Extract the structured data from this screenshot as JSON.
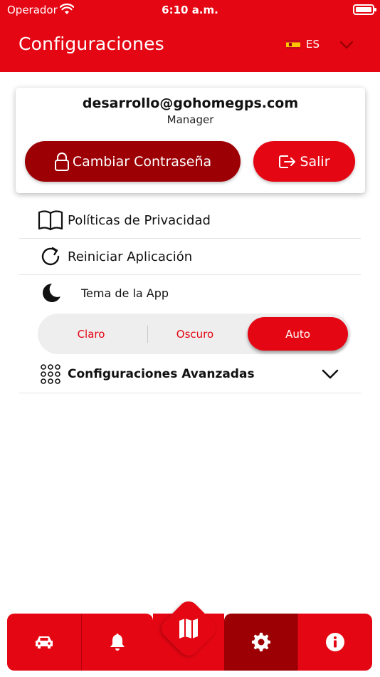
{
  "status_bar": {
    "carrier": "Operador",
    "time": "6:10 a.m."
  },
  "header": {
    "title": "Configuraciones",
    "language_code": "ES",
    "language_flag": "spain-flag-icon"
  },
  "account": {
    "email": "desarrollo@gohomegps.com",
    "role": "Manager",
    "change_password_label": "Cambiar Contraseña",
    "logout_label": "Salir"
  },
  "menu": {
    "privacy_label": "Políticas de Privacidad",
    "restart_label": "Reiniciar Aplicación",
    "theme_label": "Tema de la App",
    "advanced_label": "Configuraciones Avanzadas"
  },
  "theme_options": {
    "light": "Claro",
    "dark": "Oscuro",
    "auto": "Auto",
    "selected": "Auto"
  },
  "tabbar": {
    "items": [
      "car-icon",
      "bell-icon",
      "map-icon",
      "gear-icon",
      "info-icon"
    ],
    "active": "gear-icon"
  },
  "colors": {
    "brand_red": "#e40613",
    "dark_red": "#9c0004"
  }
}
